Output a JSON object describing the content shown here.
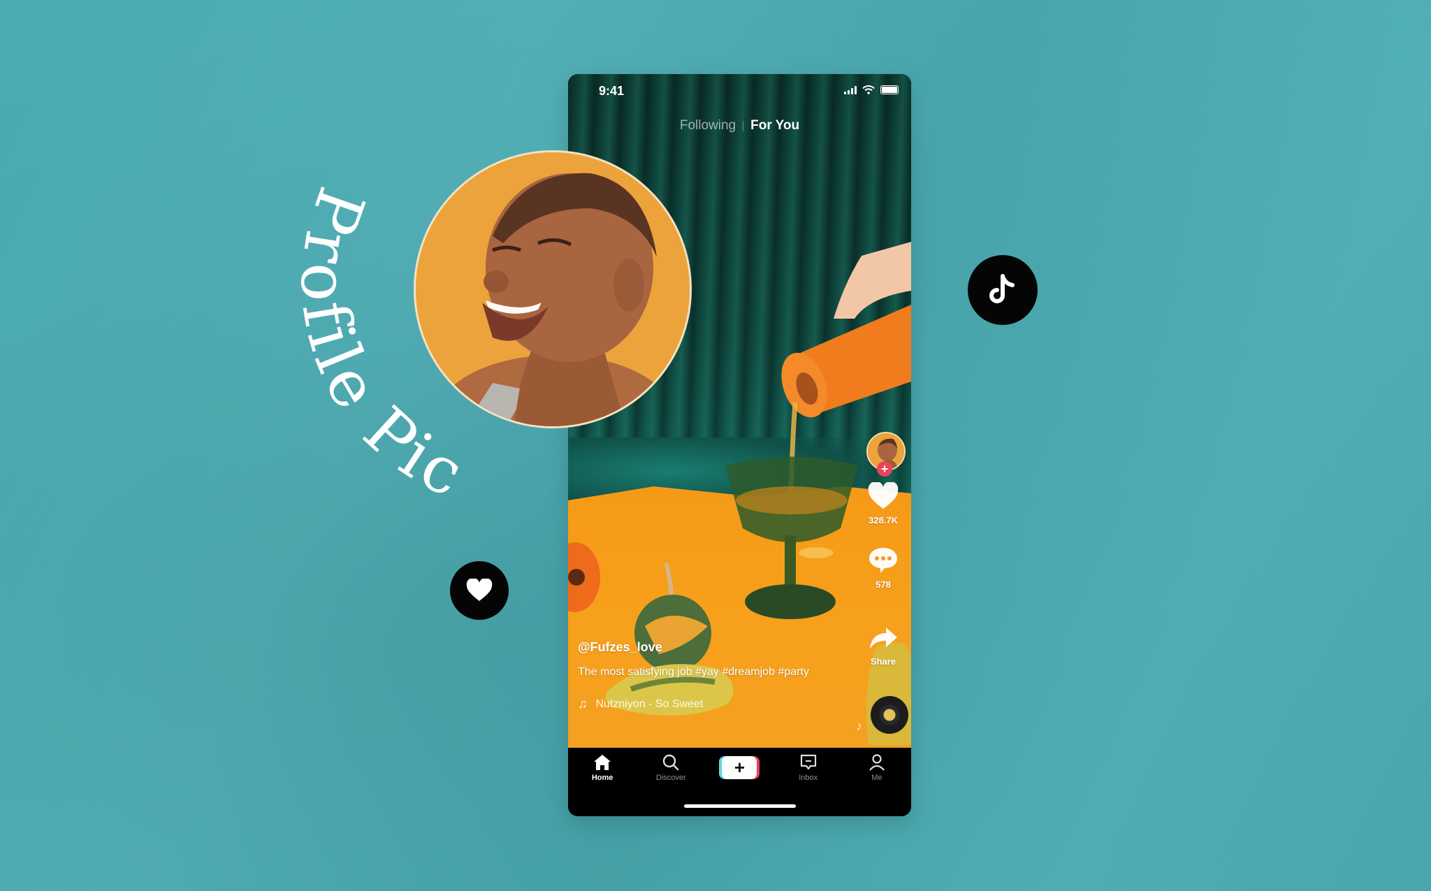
{
  "decor": {
    "arc_label": "Profile Pic",
    "background_color": "#4aa9b0",
    "badges": [
      {
        "name": "tiktok-logo",
        "icon": "tiktok-note-icon"
      },
      {
        "name": "heart",
        "icon": "heart-icon"
      }
    ]
  },
  "phone": {
    "status_bar": {
      "time": "9:41",
      "icons": [
        "cellular-signal-icon",
        "wifi-icon",
        "battery-icon"
      ]
    },
    "feed_tabs": [
      {
        "label": "Following",
        "active": false
      },
      {
        "label": "For You",
        "active": true
      }
    ],
    "actions": {
      "follow_icon": "plus-icon",
      "like": {
        "icon": "heart-icon",
        "count": "328.7K"
      },
      "comment": {
        "icon": "comment-bubble-icon",
        "count": "578"
      },
      "share": {
        "icon": "share-arrow-icon",
        "label": "Share"
      },
      "sound_disc": "music-disc-icon"
    },
    "caption": {
      "username": "@Fufzes_love",
      "description": "The most satisfying job #yay #dreamjob #party",
      "music_icon": "music-note-icon",
      "music": "Nutzniyon - So Sweet"
    },
    "bottom_nav": [
      {
        "label": "Home",
        "icon": "home-icon",
        "active": true
      },
      {
        "label": "Discover",
        "icon": "search-icon",
        "active": false
      },
      {
        "label": "",
        "icon": "create-plus-icon",
        "active": false
      },
      {
        "label": "Inbox",
        "icon": "inbox-icon",
        "active": false
      },
      {
        "label": "Me",
        "icon": "profile-icon",
        "active": false
      }
    ],
    "create_symbol": "+",
    "colors": {
      "accent_pink": "#ea445a",
      "create_cyan": "#5ed4e4",
      "create_red": "#ea3f5d",
      "table_orange": "#f59a17",
      "curtain_green": "#0f4a40"
    }
  }
}
